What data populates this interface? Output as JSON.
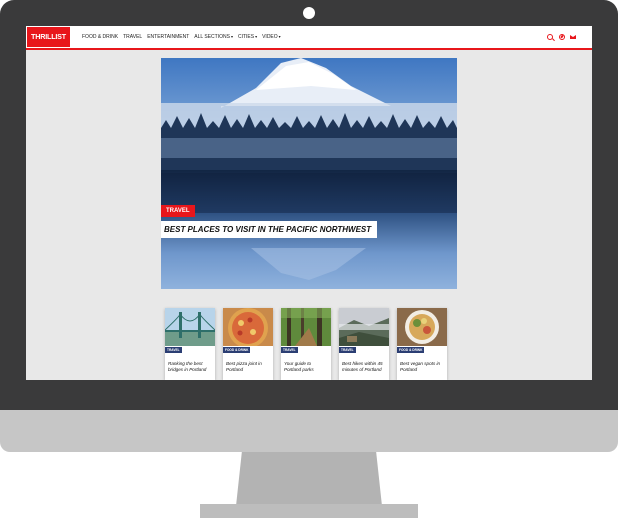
{
  "brand": {
    "logo_text": "THRILLIST",
    "accent": "#e8161b",
    "tag_blue": "#2b3e73"
  },
  "nav": {
    "items": [
      {
        "label": "FOOD & DRINK",
        "dropdown": false
      },
      {
        "label": "TRAVEL",
        "dropdown": false
      },
      {
        "label": "ENTERTAINMENT",
        "dropdown": false
      },
      {
        "label": "ALL SECTIONS",
        "dropdown": true
      },
      {
        "label": "CITIES",
        "dropdown": true
      },
      {
        "label": "VIDEO",
        "dropdown": true
      }
    ],
    "icons": [
      "search-icon",
      "compass-icon",
      "mail-icon"
    ]
  },
  "hero": {
    "tag": "TRAVEL",
    "title": "BEST PLACES TO VISIT IN THE PACIFIC NORTHWEST"
  },
  "cards": [
    {
      "tag": "TRAVEL",
      "title": "Ranking the best bridges in Portland",
      "thumb": "bridge"
    },
    {
      "tag": "FOOD & DRINK",
      "title": "Best pizza joint in Portland",
      "thumb": "pizza"
    },
    {
      "tag": "TRAVEL",
      "title": "Your guide to Portland parks",
      "thumb": "forest"
    },
    {
      "tag": "TRAVEL",
      "title": "Best hikes within 45 minutes of Portland",
      "thumb": "hike"
    },
    {
      "tag": "FOOD & DRINK",
      "title": "Best vegan spots in Portland",
      "thumb": "vegan"
    }
  ]
}
